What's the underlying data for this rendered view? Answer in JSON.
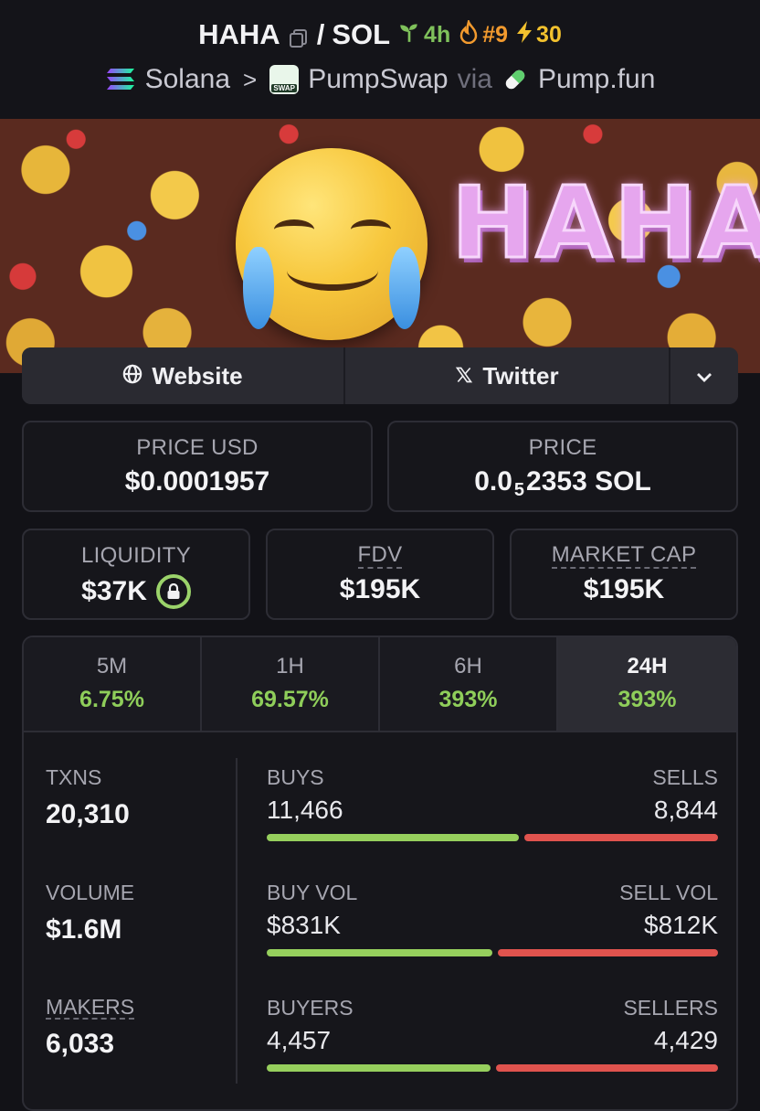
{
  "header": {
    "token": "HAHA",
    "pair_sep": "/",
    "quote": "SOL",
    "age": "4h",
    "rank": "#9",
    "boosts": "30",
    "chain": "Solana",
    "chevron": ">",
    "dex": "PumpSwap",
    "via": "via",
    "launchpad": "Pump.fun",
    "swap_badge_text": "SWAP"
  },
  "banner": {
    "art_text": "HAHA"
  },
  "links": {
    "website": "Website",
    "twitter": "Twitter"
  },
  "price": {
    "usd_label": "PRICE USD",
    "usd_value": "$0.0001957",
    "native_label": "PRICE",
    "native_prefix": "0.0",
    "native_zeros": "5",
    "native_digits": "2353",
    "native_unit": "SOL"
  },
  "metrics": {
    "liquidity_label": "LIQUIDITY",
    "liquidity_value": "$37K",
    "fdv_label": "FDV",
    "fdv_value": "$195K",
    "mcap_label": "MARKET CAP",
    "mcap_value": "$195K"
  },
  "timeframes": [
    {
      "label": "5M",
      "change": "6.75%"
    },
    {
      "label": "1H",
      "change": "69.57%"
    },
    {
      "label": "6H",
      "change": "393%"
    },
    {
      "label": "24H",
      "change": "393%"
    }
  ],
  "stats": {
    "txns_label": "TXNS",
    "txns": "20,310",
    "volume_label": "VOLUME",
    "volume": "$1.6M",
    "makers_label": "MAKERS",
    "makers": "6,033",
    "buys_label": "BUYS",
    "buys": "11,466",
    "sells_label": "SELLS",
    "sells": "8,844",
    "buy_vol_label": "BUY VOL",
    "buy_vol": "$831K",
    "sell_vol_label": "SELL VOL",
    "sell_vol": "$812K",
    "buyers_label": "BUYERS",
    "buyers": "4,457",
    "sellers_label": "SELLERS",
    "sellers": "4,429",
    "buy_share_txns": 0.565,
    "buy_share_vol": 0.506,
    "buy_share_makers": 0.502
  },
  "colors": {
    "positive": "#8fce5a",
    "buy_bar": "#96cf5d",
    "sell_bar": "#e0534e",
    "background": "#121217"
  },
  "icons": [
    "copy-icon",
    "seedling-icon",
    "flame-icon",
    "lightning-icon",
    "solana-logo",
    "pumpswap-logo",
    "pill-logo",
    "globe-icon",
    "x-logo-icon",
    "chevron-down-icon",
    "lock-icon"
  ]
}
